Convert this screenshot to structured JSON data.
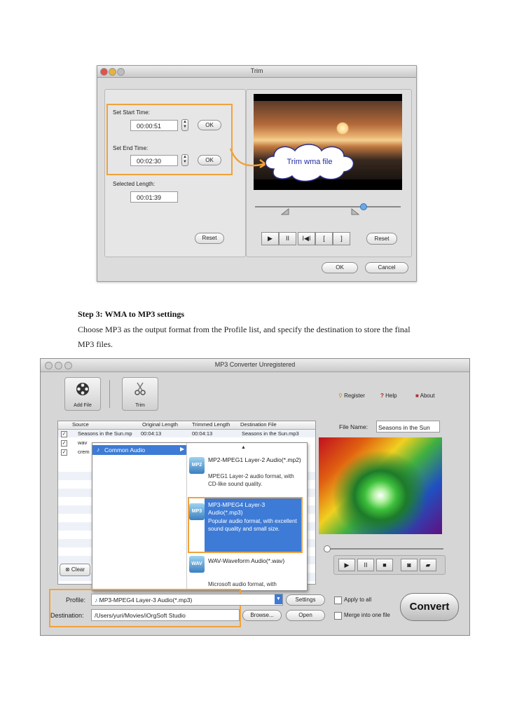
{
  "trim_window": {
    "title": "Trim",
    "start_label": "Set Start Time:",
    "start_value": "00:00:51",
    "end_label": "Set End Time:",
    "end_value": "00:02:30",
    "ok_label": "OK",
    "selected_label": "Selected Length:",
    "selected_value": "00:01:39",
    "reset_left": "Reset",
    "reset_right": "Reset",
    "callout": "Trim wma file",
    "ok_button": "OK",
    "cancel_button": "Cancel",
    "controls": [
      "▶",
      "II",
      "I◀I",
      "[",
      "]"
    ]
  },
  "step": {
    "heading": "Step 3: WMA to MP3 settings",
    "line1": "Choose MP3 as the output format from the Profile list, and specify the destination to store the final",
    "line2": "MP3 files."
  },
  "converter_window": {
    "title": "MP3 Converter Unregistered",
    "add_file": "Add File",
    "trim": "Trim",
    "register": "Register",
    "help": "Help",
    "about": "About",
    "columns": [
      "Source",
      "Original Length",
      "Trimmed Length",
      "Destination File"
    ],
    "rows": [
      {
        "source": "Seasons in the Sun.mp",
        "original": "00:04:13",
        "trimmed": "00:04:13",
        "dest": "Seasons in the Sun.mp3"
      },
      {
        "source": "wav",
        "original": "",
        "trimmed": "",
        "dest": ""
      },
      {
        "source": "crem",
        "original": "",
        "trimmed": "",
        "dest": ""
      }
    ],
    "category": "Common Audio",
    "formats": [
      {
        "icon": "MP2",
        "title": "MP2-MPEG1 Layer-2 Audio(*.mp2)",
        "desc": "MPEG1 Layer-2 audio format, with CD-like sound quality."
      },
      {
        "icon": "MP3",
        "title": "MP3-MPEG4 Layer-3 Audio(*.mp3)",
        "desc": "Popular audio format, with excellent sound quality and small size."
      },
      {
        "icon": "WAV",
        "title": "WAV-Waveform Audio(*.wav)",
        "desc": "Microsoft audio format, with"
      }
    ],
    "clear": "Clear",
    "file_name_label": "File Name:",
    "file_name_value": "Seasons in the Sun",
    "profile_label": "Profile:",
    "profile_value": "MP3-MPEG4 Layer-3 Audio(*.mp3)",
    "settings": "Settings",
    "apply_all": "Apply to all",
    "destination_label": "Destination:",
    "destination_value": "/Users/yuri/Movies/iOrgSoft Studio",
    "browse": "Browse...",
    "open": "Open",
    "merge": "Merge into one file",
    "convert": "Convert"
  }
}
